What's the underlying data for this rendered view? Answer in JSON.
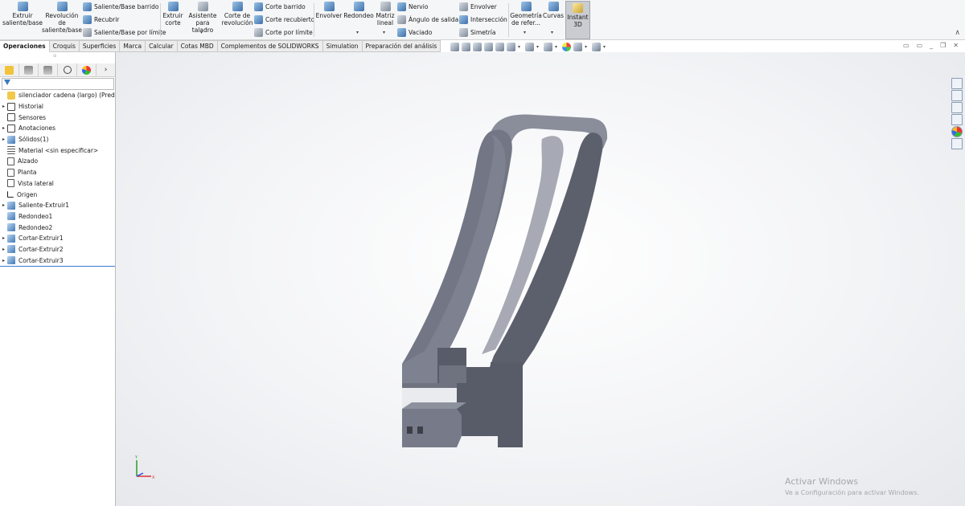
{
  "ribbon": {
    "extrude_boss": "Extruir saliente/base",
    "revolve_boss": "Revolución de saliente/base",
    "swept_boss": "Saliente/Base barrido",
    "lofted_boss": "Recubrir",
    "boundary_boss": "Saliente/Base por límite",
    "extrude_cut": "Extruir corte",
    "hole_wizard": "Asistente para taladro",
    "revolve_cut": "Corte de revolución",
    "swept_cut": "Corte barrido",
    "lofted_cut": "Corte recubierto",
    "boundary_cut": "Corte por límite",
    "wrap": "Envolver",
    "fillet": "Redondeo",
    "linear_pattern": "Matriz lineal",
    "rib": "Nervio",
    "draft": "Ángulo de salida",
    "shell": "Vaciado",
    "wrap2": "Envolver",
    "intersect": "Intersección",
    "mirror": "Simetría",
    "reference_geometry": "Geometría de refer...",
    "curves": "Curvas",
    "instant3d": "Instant 3D"
  },
  "tabs": [
    "Operaciones",
    "Croquis",
    "Superficies",
    "Marca",
    "Calcular",
    "Cotas MBD",
    "Complementos de SOLIDWORKS",
    "Simulation",
    "Preparación del análisis"
  ],
  "tree": {
    "part": "silenciador cadena (largo) (Predet",
    "items": [
      "Historial",
      "Sensores",
      "Anotaciones",
      "Sólidos(1)",
      "Material <sin especificar>",
      "Alzado",
      "Planta",
      "Vista lateral",
      "Origen",
      "Saliente-Extruir1",
      "Redondeo1",
      "Redondeo2",
      "Cortar-Extruir1",
      "Cortar-Extruir2",
      "Cortar-Extruir3"
    ]
  },
  "watermark": {
    "title": "Activar Windows",
    "subtitle": "Ve a Configuración para activar Windows."
  },
  "colors": {
    "model_face": "#737785",
    "model_dark": "#4f535f",
    "model_light": "#9a9eaa",
    "accent": "#3a7bd5"
  }
}
